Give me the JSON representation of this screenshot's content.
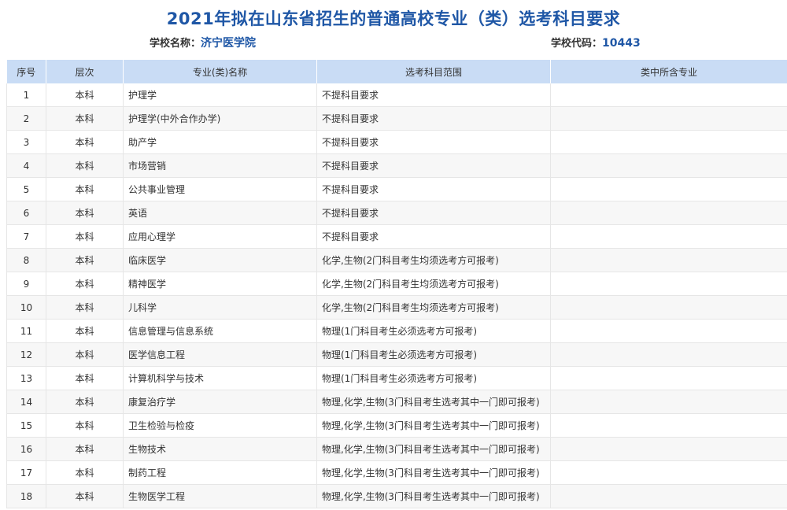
{
  "title": "2021年拟在山东省招生的普通高校专业（类）选考科目要求",
  "school": {
    "name_label": "学校名称：",
    "name": "济宁医学院",
    "code_label": "学校代码：",
    "code": "10443"
  },
  "table": {
    "headers": [
      "序号",
      "层次",
      "专业(类)名称",
      "选考科目范围",
      "类中所含专业"
    ],
    "rows": [
      [
        "1",
        "本科",
        "护理学",
        "不提科目要求",
        ""
      ],
      [
        "2",
        "本科",
        "护理学(中外合作办学)",
        "不提科目要求",
        ""
      ],
      [
        "3",
        "本科",
        "助产学",
        "不提科目要求",
        ""
      ],
      [
        "4",
        "本科",
        "市场营销",
        "不提科目要求",
        ""
      ],
      [
        "5",
        "本科",
        "公共事业管理",
        "不提科目要求",
        ""
      ],
      [
        "6",
        "本科",
        "英语",
        "不提科目要求",
        ""
      ],
      [
        "7",
        "本科",
        "应用心理学",
        "不提科目要求",
        ""
      ],
      [
        "8",
        "本科",
        "临床医学",
        "化学,生物(2门科目考生均须选考方可报考)",
        ""
      ],
      [
        "9",
        "本科",
        "精神医学",
        "化学,生物(2门科目考生均须选考方可报考)",
        ""
      ],
      [
        "10",
        "本科",
        "儿科学",
        "化学,生物(2门科目考生均须选考方可报考)",
        ""
      ],
      [
        "11",
        "本科",
        "信息管理与信息系统",
        "物理(1门科目考生必须选考方可报考)",
        ""
      ],
      [
        "12",
        "本科",
        "医学信息工程",
        "物理(1门科目考生必须选考方可报考)",
        ""
      ],
      [
        "13",
        "本科",
        "计算机科学与技术",
        "物理(1门科目考生必须选考方可报考)",
        ""
      ],
      [
        "14",
        "本科",
        "康复治疗学",
        "物理,化学,生物(3门科目考生选考其中一门即可报考)",
        ""
      ],
      [
        "15",
        "本科",
        "卫生检验与检疫",
        "物理,化学,生物(3门科目考生选考其中一门即可报考)",
        ""
      ],
      [
        "16",
        "本科",
        "生物技术",
        "物理,化学,生物(3门科目考生选考其中一门即可报考)",
        ""
      ],
      [
        "17",
        "本科",
        "制药工程",
        "物理,化学,生物(3门科目考生选考其中一门即可报考)",
        ""
      ],
      [
        "18",
        "本科",
        "生物医学工程",
        "物理,化学,生物(3门科目考生选考其中一门即可报考)",
        ""
      ]
    ]
  },
  "colors": {
    "accent": "#1f57a6",
    "header_bg": "#c9dcf5"
  }
}
